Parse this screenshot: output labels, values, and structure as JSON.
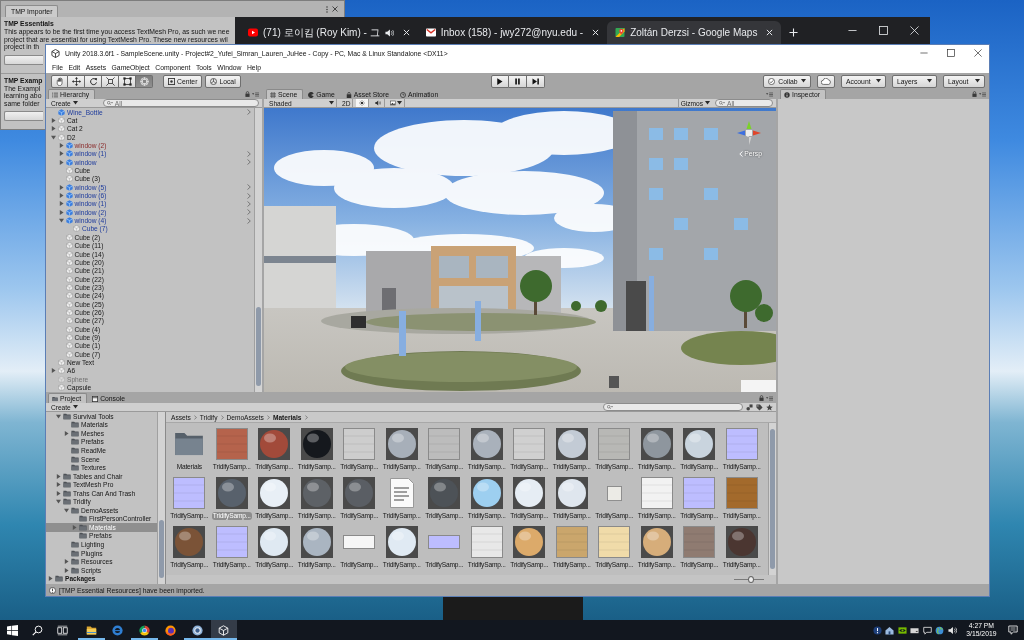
{
  "tmp_importer": {
    "title": "TMP Importer",
    "sections": [
      {
        "heading": "TMP Essentials",
        "lines": [
          "This appears to be the first time you access TextMesh Pro, as such we nee",
          "project that are essential for using TextMesh Pro. These new resources wil",
          "project in th"
        ]
      },
      {
        "heading": "TMP Examp",
        "lines": [
          "The Exampl",
          "learning abo",
          "same folder"
        ]
      }
    ]
  },
  "browser": {
    "tabs": [
      {
        "kind": "video",
        "title": "(71) 로이킴 (Roy Kim) - 그",
        "audio": true,
        "selected": false
      },
      {
        "kind": "mail",
        "title": "Inbox (158) - jwy272@nyu.edu -",
        "audio": false,
        "selected": false
      },
      {
        "kind": "map",
        "title": "Zoltán Derzsi - Google Maps",
        "audio": false,
        "selected": true
      }
    ]
  },
  "unity": {
    "window": {
      "title": "Unity 2018.3.6f1 - SampleScene.unity - Project#2_Yufei_Simran_Lauren_JuHee - Copy - PC, Mac & Linux Standalone <DX11>"
    },
    "menu": [
      "File",
      "Edit",
      "Assets",
      "GameObject",
      "Component",
      "Tools",
      "Window",
      "Help"
    ],
    "toolbar": {
      "tools": [
        {
          "kind": "hand",
          "selected": false
        },
        {
          "kind": "move",
          "selected": false
        },
        {
          "kind": "rotate",
          "selected": false
        },
        {
          "kind": "scale",
          "selected": false
        },
        {
          "kind": "rect",
          "selected": false
        },
        {
          "kind": "transform",
          "selected": true
        }
      ],
      "pivot": [
        {
          "kind": "pivot",
          "label": "Center"
        },
        {
          "kind": "space",
          "label": "Local"
        }
      ],
      "collab": "Collab",
      "account": "Account",
      "layers": "Layers",
      "layout": "Layout"
    },
    "hierarchy": {
      "title": "Hierarchy",
      "create": "Create",
      "search": {
        "placeholder": "All"
      },
      "items": [
        {
          "label": "Wine_Bottle",
          "kind": "prefab",
          "disabled": false
        },
        {
          "label": "Cat",
          "kind": "object",
          "expanded": false,
          "disabled": false
        },
        {
          "label": "Cat 2",
          "kind": "object",
          "expanded": false,
          "disabled": false
        },
        {
          "label": "D2",
          "kind": "object",
          "expanded": true,
          "disabled": false,
          "children": [
            {
              "label": "window (2)",
              "kind": "missing_prefab",
              "expanded": false,
              "disabled": false
            },
            {
              "label": "window (1)",
              "kind": "prefab",
              "expanded": false,
              "disabled": false
            },
            {
              "label": "window",
              "kind": "prefab",
              "expanded": false,
              "disabled": false
            },
            {
              "label": "Cube",
              "kind": "object",
              "disabled": false
            },
            {
              "label": "Cube (3)",
              "kind": "object",
              "disabled": false
            },
            {
              "label": "window (5)",
              "kind": "prefab",
              "expanded": false,
              "disabled": false
            },
            {
              "label": "window (6)",
              "kind": "prefab",
              "expanded": false,
              "disabled": false
            },
            {
              "label": "window (1)",
              "kind": "prefab",
              "expanded": false,
              "disabled": false
            },
            {
              "label": "window (2)",
              "kind": "prefab",
              "expanded": false,
              "disabled": false
            },
            {
              "label": "window (4)",
              "kind": "prefab",
              "expanded": true,
              "disabled": false,
              "children": [
                {
                  "label": "Cube (7)",
                  "kind": "prefab_child",
                  "disabled": false
                }
              ]
            },
            {
              "label": "Cube (2)",
              "kind": "object",
              "disabled": false
            },
            {
              "label": "Cube (11)",
              "kind": "object",
              "disabled": false
            },
            {
              "label": "Cube (14)",
              "kind": "object",
              "disabled": false
            },
            {
              "label": "Cube (20)",
              "kind": "object",
              "disabled": false
            },
            {
              "label": "Cube (21)",
              "kind": "object",
              "disabled": false
            },
            {
              "label": "Cube (22)",
              "kind": "object",
              "disabled": false
            },
            {
              "label": "Cube (23)",
              "kind": "object",
              "disabled": false
            },
            {
              "label": "Cube (24)",
              "kind": "object",
              "disabled": false
            },
            {
              "label": "Cube (25)",
              "kind": "object",
              "disabled": false
            },
            {
              "label": "Cube (26)",
              "kind": "object",
              "disabled": false
            },
            {
              "label": "Cube (27)",
              "kind": "object",
              "disabled": false
            },
            {
              "label": "Cube (4)",
              "kind": "object",
              "disabled": false
            },
            {
              "label": "Cube (9)",
              "kind": "object",
              "disabled": false
            },
            {
              "label": "Cube (1)",
              "kind": "object",
              "disabled": false
            },
            {
              "label": "Cube (7)",
              "kind": "object",
              "disabled": false
            }
          ]
        },
        {
          "label": "New Text",
          "kind": "object",
          "disabled": false
        },
        {
          "label": "A6",
          "kind": "object",
          "expanded": false,
          "disabled": false
        },
        {
          "label": "Sphere",
          "kind": "object",
          "disabled": true
        },
        {
          "label": "Capsule",
          "kind": "object",
          "disabled": false
        }
      ]
    },
    "scene": {
      "tabs": [
        {
          "kind": "scene",
          "label": "Scene",
          "selected": true
        },
        {
          "kind": "game",
          "label": "Game",
          "selected": false
        },
        {
          "kind": "store",
          "label": "Asset Store",
          "selected": false
        },
        {
          "kind": "animation",
          "label": "Animation",
          "selected": false
        }
      ],
      "shading": "Shaded",
      "toggles": [
        {
          "kind": "mode_2d",
          "label": "2D",
          "on": false
        },
        {
          "kind": "lighting",
          "on": true
        },
        {
          "kind": "audio",
          "on": false
        }
      ],
      "gizmos": "Gizmos",
      "search": {
        "placeholder": "All"
      },
      "projection": "Persp"
    },
    "inspector": {
      "title": "Inspector"
    },
    "project": {
      "tabs": [
        {
          "kind": "project",
          "label": "Project",
          "selected": true
        },
        {
          "kind": "console",
          "label": "Console",
          "selected": false
        }
      ],
      "create": "Create",
      "tree": [
        {
          "label": "Survival Tools",
          "expanded": true,
          "selected": false,
          "children": [
            {
              "label": "Materials",
              "selected": false
            },
            {
              "label": "Meshes",
              "expanded": false,
              "selected": false
            },
            {
              "label": "Prefabs",
              "selected": false
            },
            {
              "label": "ReadMe",
              "selected": false
            },
            {
              "label": "Scene",
              "selected": false
            },
            {
              "label": "Textures",
              "selected": false
            }
          ]
        },
        {
          "label": "Tables and Chair",
          "expanded": false,
          "selected": false
        },
        {
          "label": "TextMesh Pro",
          "expanded": false,
          "selected": false
        },
        {
          "label": "Trahs Can And Trash",
          "expanded": false,
          "selected": false
        },
        {
          "label": "Tridify",
          "expanded": true,
          "selected": false,
          "children": [
            {
              "label": "DemoAssets",
              "expanded": true,
              "selected": false,
              "children": [
                {
                  "label": "FirstPersonController",
                  "selected": false
                },
                {
                  "label": "Materials",
                  "expanded": false,
                  "selected": true
                },
                {
                  "label": "Prefabs",
                  "selected": false
                }
              ]
            },
            {
              "label": "Lighting",
              "selected": false
            },
            {
              "label": "Plugins",
              "selected": false
            },
            {
              "label": "Resources",
              "expanded": false,
              "selected": false
            },
            {
              "label": "Scripts",
              "expanded": false,
              "selected": false
            }
          ]
        }
      ],
      "packages": {
        "label": "Packages",
        "expanded": false,
        "selected": false
      },
      "breadcrumb": [
        "Assets",
        "Tridify",
        "DemoAssets",
        "Materials"
      ],
      "assets": [
        {
          "label": "Materials",
          "kind": "folder",
          "selected": false
        },
        {
          "label": "TridifySamp...",
          "kind": "texture",
          "color": "#b5634c",
          "selected": false
        },
        {
          "label": "TridifySamp...",
          "kind": "sphere",
          "color": "#a24a3a",
          "selected": false
        },
        {
          "label": "TridifySamp...",
          "kind": "sphere",
          "color": "#15181d",
          "selected": false
        },
        {
          "label": "TridifySamp...",
          "kind": "texture",
          "color": "#cdcdcd",
          "selected": false
        },
        {
          "label": "TridifySamp...",
          "kind": "sphere",
          "color": "#a7afb9",
          "selected": false
        },
        {
          "label": "TridifySamp...",
          "kind": "texture",
          "color": "#bcbcbc",
          "selected": false
        },
        {
          "label": "TridifySamp...",
          "kind": "sphere",
          "color": "#a9b1bb",
          "selected": false
        },
        {
          "label": "TridifySamp...",
          "kind": "texture",
          "color": "#d0d0d0",
          "selected": false
        },
        {
          "label": "TridifySamp...",
          "kind": "sphere",
          "color": "#c3cbd5",
          "selected": false
        },
        {
          "label": "TridifySamp...",
          "kind": "texture",
          "color": "#b8b8b5",
          "selected": false
        },
        {
          "label": "TridifySamp...",
          "kind": "sphere",
          "color": "#8e969e",
          "selected": false
        },
        {
          "label": "TridifySamp...",
          "kind": "sphere",
          "color": "#c9d4de",
          "selected": false
        },
        {
          "label": "TridifySamp...",
          "kind": "texture",
          "color": "#bdbdff",
          "selected": false
        },
        {
          "label": "TridifySamp...",
          "kind": "texture",
          "color": "#bdbdff",
          "selected": false
        },
        {
          "label": "TridifySamp...",
          "kind": "sphere",
          "color": "#58616c",
          "selected": true
        },
        {
          "label": "TridifySamp...",
          "kind": "sphere",
          "color": "#e8eff6",
          "selected": false
        },
        {
          "label": "TridifySamp...",
          "kind": "sphere",
          "color": "#5d6166",
          "selected": false
        },
        {
          "label": "TridifySamp...",
          "kind": "sphere",
          "color": "#5a5e64",
          "selected": false
        },
        {
          "label": "TridifySamp...",
          "kind": "document",
          "selected": false
        },
        {
          "label": "TridifySamp...",
          "kind": "sphere",
          "color": "#4d5257",
          "selected": false
        },
        {
          "label": "TridifySamp...",
          "kind": "sphere",
          "color": "#9dcff0",
          "selected": false
        },
        {
          "label": "TridifySamp...",
          "kind": "sphere",
          "color": "#e6edf4",
          "selected": false
        },
        {
          "label": "TridifySamp...",
          "kind": "sphere",
          "color": "#dfe6ee",
          "selected": false
        },
        {
          "label": "TridifySamp...",
          "kind": "swatch",
          "color": "#ecebe6",
          "selected": false
        },
        {
          "label": "TridifySamp...",
          "kind": "texture",
          "color": "#f2f2f2",
          "selected": false
        },
        {
          "label": "TridifySamp...",
          "kind": "texture",
          "color": "#bdbdff",
          "selected": false
        },
        {
          "label": "TridifySamp...",
          "kind": "texture",
          "color": "#a36a2c",
          "selected": false
        },
        {
          "label": "TridifySamp...",
          "kind": "sphere",
          "color": "#7b5337",
          "selected": false
        },
        {
          "label": "TridifySamp...",
          "kind": "texture",
          "color": "#bdbdff",
          "selected": false
        },
        {
          "label": "TridifySamp...",
          "kind": "sphere",
          "color": "#dfe9f2",
          "selected": false
        },
        {
          "label": "TridifySamp...",
          "kind": "sphere",
          "color": "#aab5c1",
          "selected": false
        },
        {
          "label": "TridifySamp...",
          "kind": "strip",
          "color": "#f6f6f6",
          "selected": false
        },
        {
          "label": "TridifySamp...",
          "kind": "sphere",
          "color": "#e0eaf3",
          "selected": false
        },
        {
          "label": "TridifySamp...",
          "kind": "strip",
          "color": "#bdbdff",
          "selected": false
        },
        {
          "label": "TridifySamp...",
          "kind": "texture",
          "color": "#e8e8e8",
          "selected": false
        },
        {
          "label": "TridifySamp...",
          "kind": "sphere",
          "color": "#dcaa6a",
          "selected": false
        },
        {
          "label": "TridifySamp...",
          "kind": "texture",
          "color": "#caa66c",
          "selected": false
        },
        {
          "label": "TridifySamp...",
          "kind": "texture",
          "color": "#f0dba9",
          "selected": false
        },
        {
          "label": "TridifySamp...",
          "kind": "sphere",
          "color": "#d6ad7a",
          "selected": false
        },
        {
          "label": "TridifySamp...",
          "kind": "texture",
          "color": "#8f7b71",
          "selected": false
        },
        {
          "label": "TridifySamp...",
          "kind": "sphere",
          "color": "#4b3631",
          "selected": false
        }
      ],
      "icon_size": {
        "level": 0.55
      }
    },
    "status_bar": {
      "message": "[TMP Essential Resources] have been imported."
    }
  },
  "taskbar": {
    "apps": [
      {
        "kind": "folder",
        "running": true,
        "selected": false
      },
      {
        "kind": "swirl",
        "running": false,
        "selected": false
      },
      {
        "kind": "ball",
        "running": true,
        "selected": false
      },
      {
        "kind": "flame",
        "running": false,
        "selected": false
      },
      {
        "kind": "ring",
        "running": true,
        "selected": false
      },
      {
        "kind": "cube",
        "running": true,
        "selected": true
      }
    ],
    "time": "4:27 PM",
    "date": "3/15/2019"
  }
}
